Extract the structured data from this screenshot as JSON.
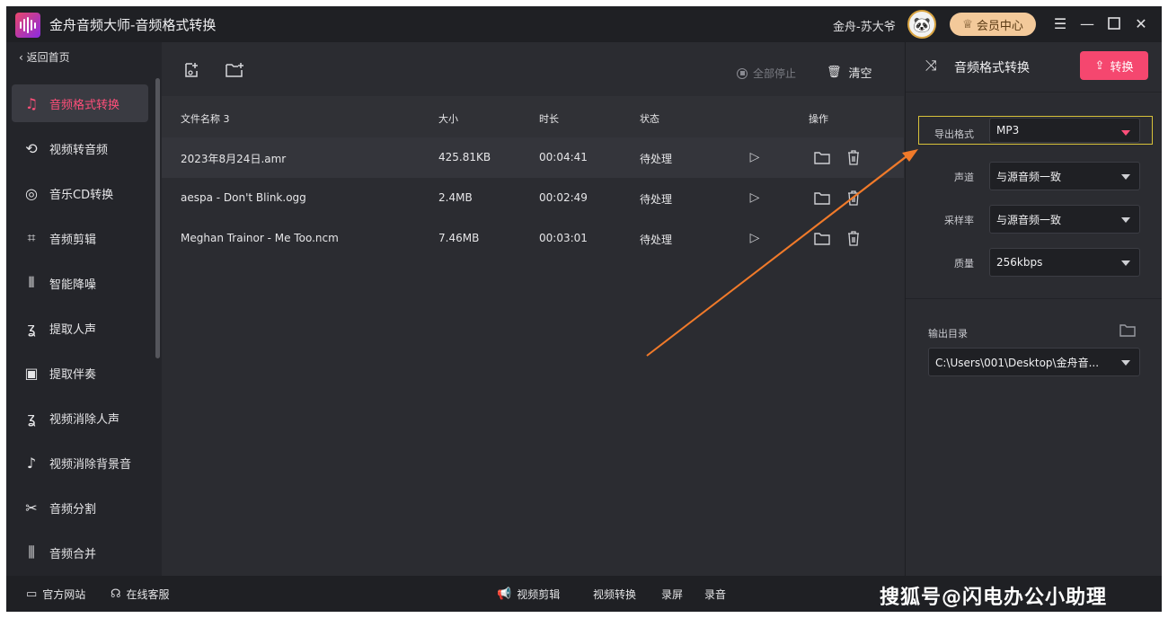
{
  "titlebar": {
    "title": "金舟音频大师-音频格式转换",
    "user": "金舟-苏大爷",
    "vip_label": "会员中心"
  },
  "sidebar": {
    "back_label": "返回首页",
    "items": [
      {
        "label": "音频格式转换",
        "icon": "music-convert-icon",
        "active": true
      },
      {
        "label": "视频转音频",
        "icon": "video-to-audio-icon"
      },
      {
        "label": "音乐CD转换",
        "icon": "cd-icon"
      },
      {
        "label": "音频剪辑",
        "icon": "clip-icon"
      },
      {
        "label": "智能降噪",
        "icon": "denoise-icon"
      },
      {
        "label": "提取人声",
        "icon": "voice-extract-icon"
      },
      {
        "label": "提取伴奏",
        "icon": "accompaniment-icon"
      },
      {
        "label": "视频消除人声",
        "icon": "remove-voice-icon"
      },
      {
        "label": "视频消除背景音",
        "icon": "remove-bg-icon"
      },
      {
        "label": "音频分割",
        "icon": "scissors-icon"
      },
      {
        "label": "音频合并",
        "icon": "merge-icon"
      }
    ]
  },
  "toolbar": {
    "stop_all_label": "全部停止",
    "clear_label": "清空"
  },
  "table": {
    "headers": {
      "name": "文件名称 3",
      "size": "大小",
      "duration": "时长",
      "status": "状态",
      "actions": "操作"
    },
    "rows": [
      {
        "name": "2023年8月24日.amr",
        "size": "425.81KB",
        "duration": "00:04:41",
        "status": "待处理"
      },
      {
        "name": "aespa - Don't Blink.ogg",
        "size": "2.4MB",
        "duration": "00:02:49",
        "status": "待处理"
      },
      {
        "name": "Meghan Trainor - Me Too.ncm",
        "size": "7.46MB",
        "duration": "00:03:01",
        "status": "待处理"
      }
    ]
  },
  "panel": {
    "title": "音频格式转换",
    "convert_label": "转换",
    "format_label": "导出格式",
    "format_value": "MP3",
    "channel_label": "声道",
    "channel_value": "与源音频一致",
    "samplerate_label": "采样率",
    "samplerate_value": "与源音频一致",
    "quality_label": "质量",
    "quality_value": "256kbps",
    "output_label": "输出目录",
    "output_value": "C:\\Users\\001\\Desktop\\金舟音..."
  },
  "bottombar": {
    "website": "官方网站",
    "service": "在线客服",
    "video_edit": "视频剪辑",
    "video_convert": "视频转换",
    "screen_record": "录屏",
    "audio_record": "录音",
    "watermark": "搜狐号@闪电办公小助理"
  },
  "colors": {
    "accent": "#f5476f",
    "highlight_border": "#d8c23a",
    "arrow": "#f07a2a"
  }
}
